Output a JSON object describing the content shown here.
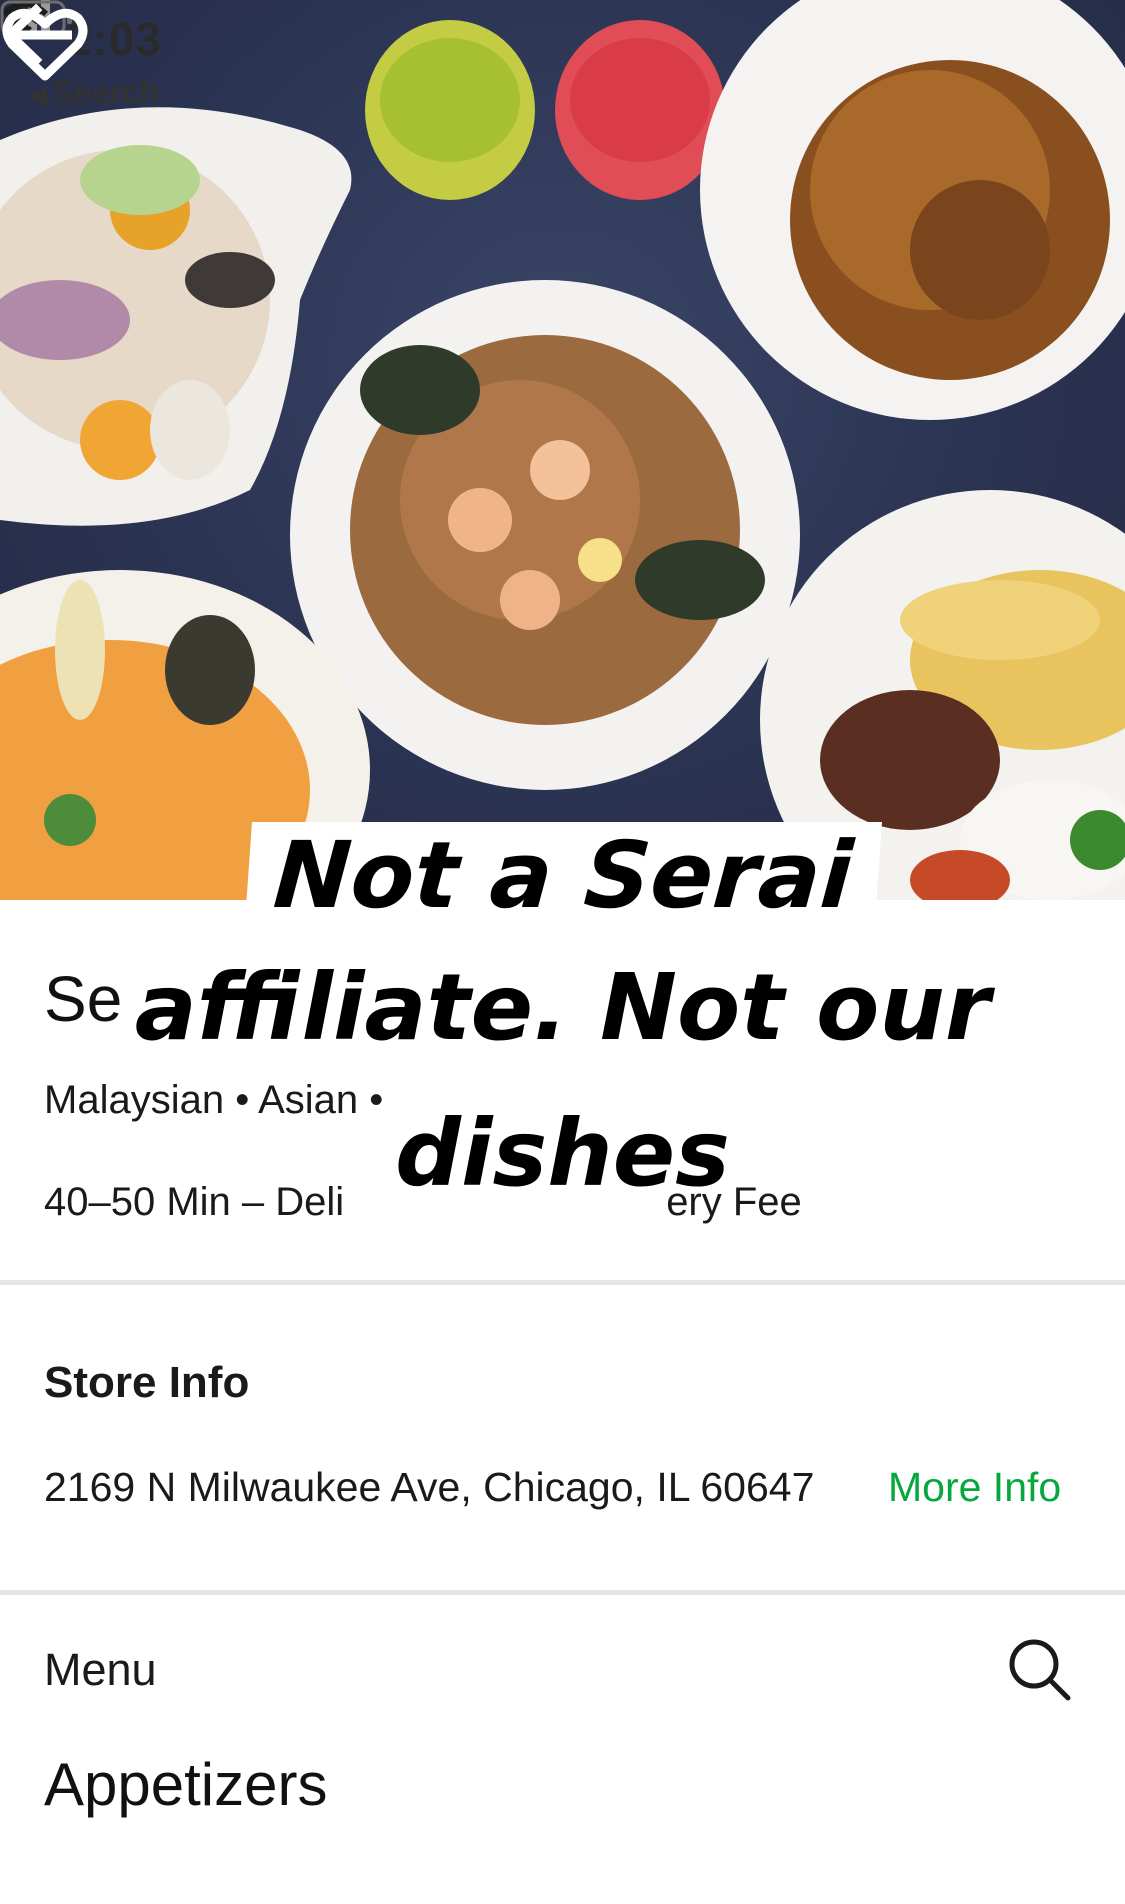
{
  "status_bar": {
    "time": "2:03",
    "back_app_label": "Search"
  },
  "hero": {
    "alt": "",
    "icons": [
      "back-arrow-icon",
      "heart-icon"
    ]
  },
  "overlay_caption": {
    "line1": "Not a Serai",
    "line2": "affiliate. Not our",
    "line3": "dishes"
  },
  "store": {
    "name_visible": "Se",
    "cuisine_visible": "Malaysian • Asian •",
    "eta_visible": "40–50 Min – Deli",
    "fee_visible": "ery Fee"
  },
  "store_info": {
    "title": "Store Info",
    "address": "2169 N Milwaukee Ave, Chicago, IL 60647",
    "more_info": "More Info"
  },
  "menu": {
    "label": "Menu",
    "first_category": "Appetizers"
  },
  "colors": {
    "accent": "#06a83e",
    "divider": "#e6e6e6"
  }
}
